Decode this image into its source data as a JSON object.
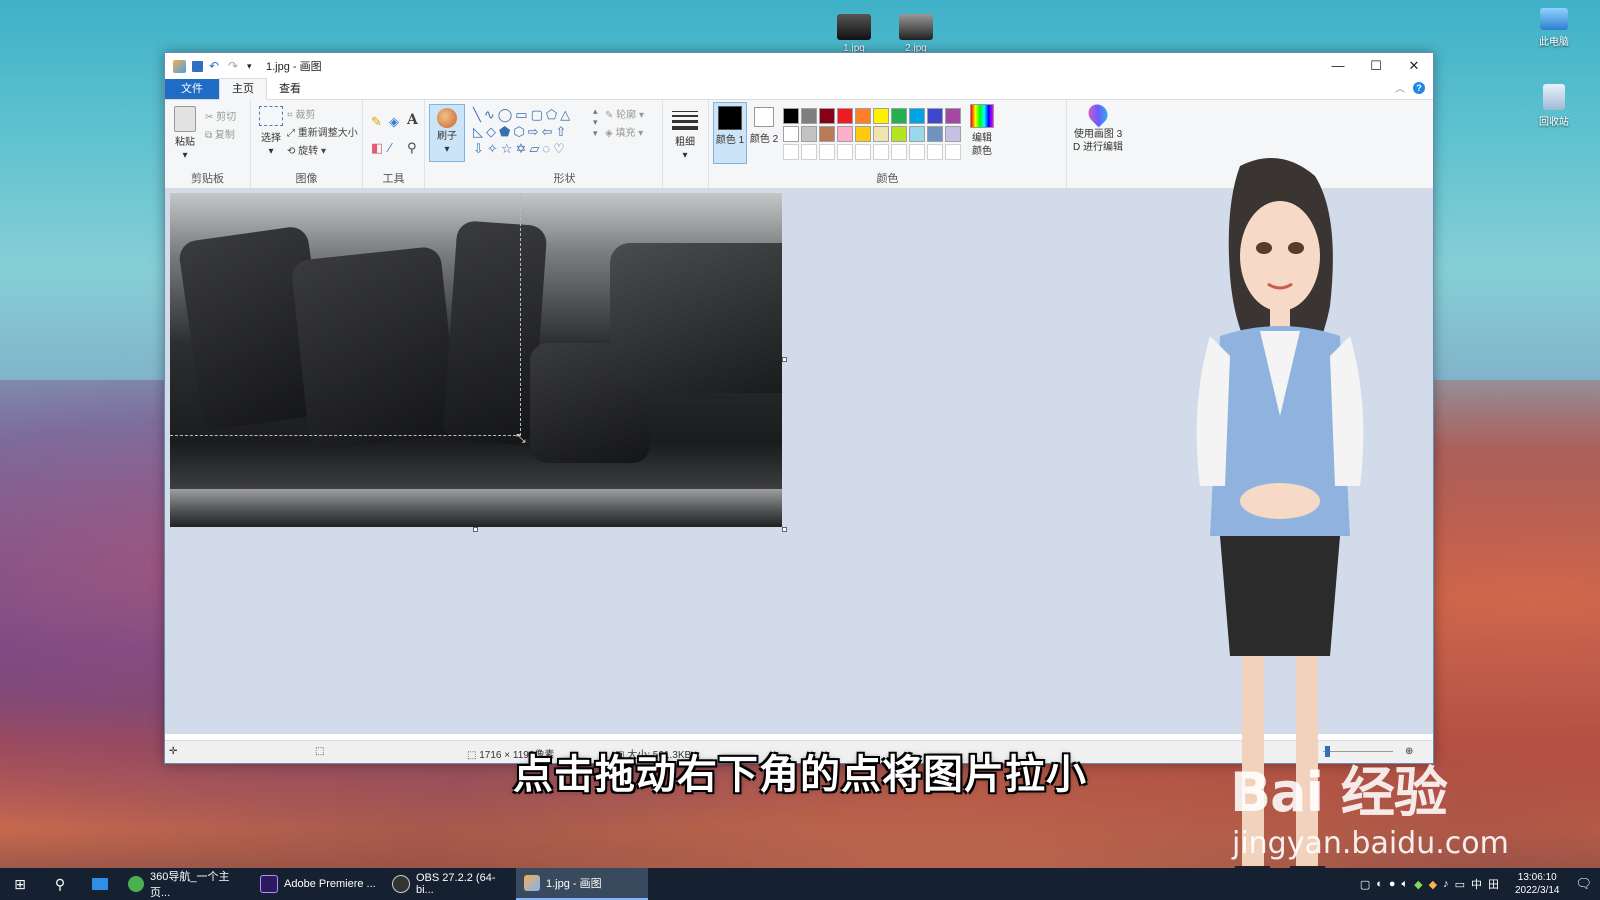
{
  "desktop": {
    "icons": [
      {
        "label": "1.jpg"
      },
      {
        "label": "2.jpg"
      },
      {
        "label": "此电脑"
      },
      {
        "label": "回收站"
      }
    ]
  },
  "window": {
    "title": "1.jpg - 画图",
    "controls": {
      "minimize": "—",
      "maximize": "☐",
      "close": "✕"
    }
  },
  "tabs": {
    "file": "文件",
    "home": "主页",
    "view": "查看"
  },
  "ribbon": {
    "clipboard": {
      "paste": "粘贴",
      "cut": "剪切",
      "copy": "复制",
      "group": "剪贴板"
    },
    "image": {
      "select": "选择",
      "crop": "裁剪",
      "resize": "重新调整大小",
      "rotate": "旋转",
      "group": "图像"
    },
    "tools": {
      "group": "工具"
    },
    "brush": {
      "label": "刷子"
    },
    "shapes": {
      "outline": "轮廓",
      "fill": "填充",
      "group": "形状"
    },
    "size": {
      "label": "粗细"
    },
    "colors": {
      "color1": "颜色 1",
      "color2": "颜色 2",
      "edit": "编辑颜色",
      "group": "颜色",
      "color1_value": "#000000",
      "color2_value": "#ffffff",
      "palette": [
        "#000000",
        "#7f7f7f",
        "#880015",
        "#ed1c24",
        "#ff7f27",
        "#fff200",
        "#22b14c",
        "#00a2e8",
        "#3f48cc",
        "#a349a4",
        "#ffffff",
        "#c3c3c3",
        "#b97a57",
        "#ffaec9",
        "#ffc90e",
        "#efe4b0",
        "#b5e61d",
        "#99d9ea",
        "#7092be",
        "#c8bfe7",
        "#ffffff",
        "#ffffff",
        "#ffffff",
        "#ffffff",
        "#ffffff",
        "#ffffff",
        "#ffffff",
        "#ffffff",
        "#ffffff",
        "#ffffff"
      ]
    },
    "paint3d": {
      "label": "使用画图 3 D 进行编辑"
    }
  },
  "status": {
    "dimensions": "1716 × 1192像素",
    "size": "大小: 501.3KB"
  },
  "overlay": {
    "subtitle": "点击拖动右下角的点将图片拉小",
    "watermark_logo": "Bai 经验",
    "watermark_url": "jingyan.baidu.com"
  },
  "taskbar": {
    "apps": [
      {
        "label": "360导航_一个主页...",
        "color": "#4caf50"
      },
      {
        "label": "Adobe Premiere ...",
        "color": "#2a1a5e"
      },
      {
        "label": "OBS 27.2.2 (64-bi...",
        "color": "#333333"
      },
      {
        "label": "1.jpg - 画图",
        "color": "#7fb4ff"
      }
    ],
    "tray": {
      "ime": "中",
      "grid": "田"
    },
    "clock": {
      "time": "13:06:10",
      "date": "2022/3/14"
    }
  }
}
